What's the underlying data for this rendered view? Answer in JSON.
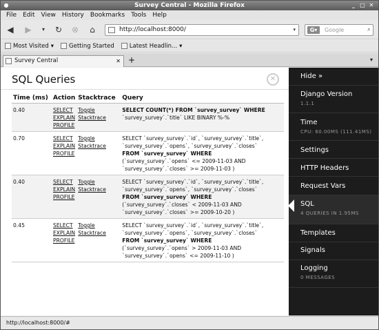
{
  "window": {
    "title": "Survey Central - Mozilla Firefox"
  },
  "menu": [
    "File",
    "Edit",
    "View",
    "History",
    "Bookmarks",
    "Tools",
    "Help"
  ],
  "nav": {
    "url": "http://localhost:8000/",
    "search_placeholder": "Google"
  },
  "bookmarks": [
    "Most Visited",
    "Getting Started",
    "Latest Headlin..."
  ],
  "tab": {
    "label": "Survey Central"
  },
  "sql": {
    "title": "SQL Queries",
    "columns": [
      "Time (ms)",
      "Action",
      "Stacktrace",
      "Query"
    ],
    "actions": [
      "SELECT",
      "EXPLAIN",
      "PROFILE"
    ],
    "stack": [
      "Toggle",
      "Stacktrace"
    ],
    "rows": [
      {
        "time": "0.40",
        "q1": "SELECT COUNT(*) FROM `survey_survey` WHERE",
        "q2": "`survey_survey`.`title` LIKE BINARY %-%"
      },
      {
        "time": "0.70",
        "q1": "SELECT `survey_survey`.`id`, `survey_survey`.`title`,",
        "q2": "`survey_survey`.`opens`, `survey_survey`.`closes`",
        "q3": "FROM `survey_survey` WHERE",
        "q4": "(`survey_survey`.`opens` <= 2009-11-03 AND",
        "q5": "`survey_survey`.`closes` >= 2009-11-03 )"
      },
      {
        "time": "0.40",
        "q1": "SELECT `survey_survey`.`id`, `survey_survey`.`title`,",
        "q2": "`survey_survey`.`opens`, `survey_survey`.`closes`",
        "q3": "FROM `survey_survey` WHERE",
        "q4": "(`survey_survey`.`closes` < 2009-11-03 AND",
        "q5": "`survey_survey`.`closes` >= 2009-10-20 )"
      },
      {
        "time": "0.45",
        "q1": "SELECT `survey_survey`.`id`, `survey_survey`.`title`,",
        "q2": "`survey_survey`.`opens`, `survey_survey`.`closes`",
        "q3": "FROM `survey_survey` WHERE",
        "q4": "(`survey_survey`.`opens` > 2009-11-03 AND",
        "q5": "`survey_survey`.`opens` <= 2009-11-10 )"
      }
    ]
  },
  "sidebar": {
    "hide": "Hide »",
    "items": [
      {
        "label": "Django Version",
        "sub": "1.1.1"
      },
      {
        "label": "Time",
        "sub": "CPU: 60.00MS (111.41MS)"
      },
      {
        "label": "Settings",
        "sub": ""
      },
      {
        "label": "HTTP Headers",
        "sub": ""
      },
      {
        "label": "Request Vars",
        "sub": ""
      },
      {
        "label": "SQL",
        "sub": "4 QUERIES IN 1.95MS"
      },
      {
        "label": "Templates",
        "sub": ""
      },
      {
        "label": "Signals",
        "sub": ""
      },
      {
        "label": "Logging",
        "sub": "0 MESSAGES"
      }
    ]
  },
  "status": {
    "text": "http://localhost:8000/#"
  }
}
